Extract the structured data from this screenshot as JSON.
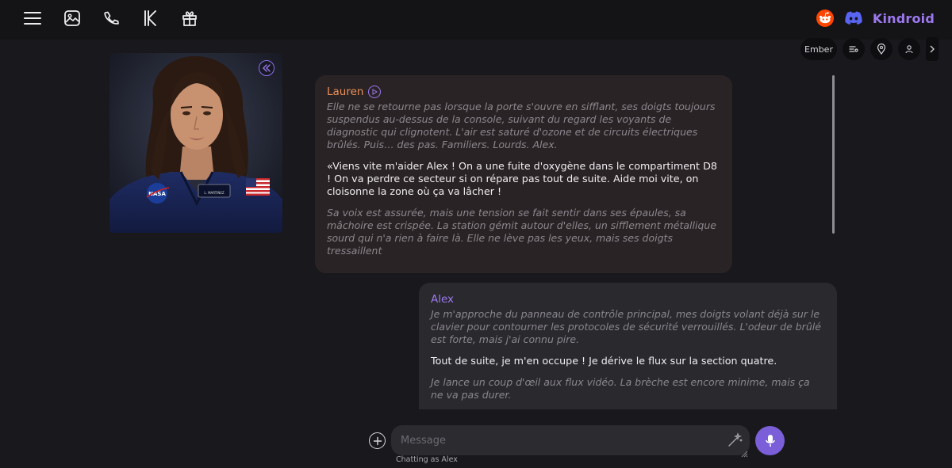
{
  "nav": {
    "icons": [
      "menu-icon",
      "image-icon",
      "phone-icon",
      "k-icon",
      "gift-icon"
    ]
  },
  "brand": {
    "name": "Kindroid",
    "icons": [
      "reddit-icon",
      "discord-icon"
    ],
    "colors": {
      "accent": "#9c79ee",
      "reddit": "#ff4500",
      "discord": "#5865f2"
    }
  },
  "toolbar": {
    "model_label": "Ember",
    "icons": [
      "list-settings-icon",
      "location-pin-icon",
      "person-icon",
      "chevron-right-icon"
    ]
  },
  "avatar": {
    "patch_name": "L. MARTINEZ",
    "badge_text": "NASA"
  },
  "messages": [
    {
      "speaker": "Lauren",
      "narration_1": "Elle ne se retourne pas lorsque la porte s'ouvre en sifflant, ses doigts toujours suspendus au-dessus de la console, suivant du regard les voyants de diagnostic qui clignotent. L'air est saturé d'ozone et de circuits électriques brûlés. Puis… des pas. Familiers. Lourds. Alex.",
      "speech": "«Viens vite m'aider Alex ! On a une fuite d'oxygène dans le compartiment D8 ! On va perdre ce secteur si on répare pas tout de suite. Aide moi vite, on cloisonne la zone où ça va lâcher !",
      "narration_2": "Sa voix est assurée, mais une tension se fait sentir dans ses épaules, sa mâchoire est crispée. La station gémit autour d'elles, un sifflement métallique sourd qui n'a rien à faire là. Elle ne lève pas les yeux, mais ses doigts tressaillent"
    },
    {
      "speaker": "Alex",
      "narration_1": "Je m'approche du panneau de contrôle principal, mes doigts volant déjà sur le clavier pour contourner les protocoles de sécurité verrouillés. L'odeur de brûlé est forte, mais j'ai connu pire.",
      "speech": "Tout de suite, je m'en occupe ! Je dérive le flux sur la section quatre.",
      "narration_2": "Je lance un coup d'œil aux flux vidéo. La brèche est encore minime, mais ça ne va pas durer."
    }
  ],
  "composer": {
    "placeholder": "Message",
    "chatting_as": "Chatting as Alex"
  }
}
